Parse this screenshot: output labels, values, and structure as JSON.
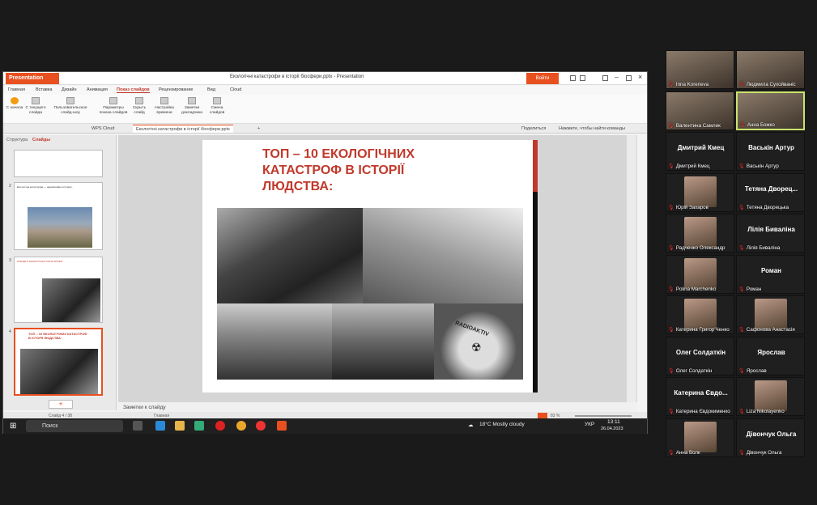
{
  "window": {
    "app_label": "Presentation",
    "title": "Екологічні катастрофи в історії біосфери.pptx - Presentation",
    "login": "Войти"
  },
  "menu": [
    "Главная",
    "Вставка",
    "Дизайн",
    "Анимация",
    "Показ слайдов",
    "Рецензирование",
    "Вид",
    "Cloud"
  ],
  "ribbon": [
    "С начала",
    "С текущего слайда",
    "Пользовательское слайд-шоу",
    "Параметры показа слайдов",
    "Скрыть слайд",
    "Настройка времени",
    "Заметки докладчика",
    "Смена слайдов"
  ],
  "tabs": {
    "cloud": "WPS Cloud",
    "doc": "Екологічні катастрофи в історії біосфери.pptx",
    "share": "Поделиться",
    "search": "Нажмите, чтобы найти команды"
  },
  "panel": {
    "outline": "Структура",
    "slides": "Слайды"
  },
  "thumbs": [
    {
      "num": "2",
      "text": "Екологічна катастрофа — надзвичайна ситуація..."
    },
    {
      "num": "3",
      "text": "КОНЦЕПТ ЕКОЛОГІЧНОЇ КАТАСТРОФИ..."
    },
    {
      "num": "4",
      "text": "ТОП – 10 ЕКОЛОГІЧНИХ КАТАСТРОФ В ІСТОРІЇ ЛЮДСТВА:"
    }
  ],
  "slide": {
    "title": "ТОП – 10 ЕКОЛОГІЧНИХ КАТАСТРОФ В ІСТОРІЇ ЛЮДСТВА:",
    "radio": "RADIOAKTIV"
  },
  "notes": "Заметки к слайду",
  "status": {
    "slide": "Слайд 4 / 38",
    "theme": "Главная",
    "zoom": "83 %"
  },
  "taskbar": {
    "search": "Поиск",
    "weather": "18°C  Mostly cloudy",
    "lang": "УКР",
    "time": "13:11",
    "date": "26.04.2023"
  },
  "participants": [
    {
      "name": "Inna Koreneva",
      "video": true
    },
    {
      "name": "Людмила Сухойваніс",
      "video": true
    },
    {
      "name": "Валентина Самлик",
      "video": true
    },
    {
      "name": "Анна Божко",
      "video": true,
      "selected": true
    },
    {
      "name": "Дмитрий Кмец",
      "big": "Дмитрий Кмец"
    },
    {
      "name": "Васькін Артур",
      "big": "Васькін Артур"
    },
    {
      "name": "Юрій Захаров",
      "avatar": true
    },
    {
      "name": "Тетяна Дворецька",
      "big": "Тетяна Дворец..."
    },
    {
      "name": "Радченко Олександр",
      "avatar": true
    },
    {
      "name": "Лілія Биваліна",
      "big": "Лілія Биваліна"
    },
    {
      "name": "Polina Marchenko",
      "avatar": true
    },
    {
      "name": "Роман",
      "big": "Роман"
    },
    {
      "name": "Катерина Григор'Ченко",
      "avatar": true
    },
    {
      "name": "Сафонова Анастасія",
      "avatar": true
    },
    {
      "name": "Олег Солдаткін",
      "big": "Олег Солдаткін"
    },
    {
      "name": "Ярослав",
      "big": "Ярослав"
    },
    {
      "name": "Катерина Євдокименко",
      "big": "Катерина Євдо..."
    },
    {
      "name": "Liza Nikolayenko",
      "avatar": true
    },
    {
      "name": "Анна Волк",
      "avatar": true
    },
    {
      "name": "Дівончук Ольга",
      "big": "Дівончук Ольга"
    }
  ]
}
